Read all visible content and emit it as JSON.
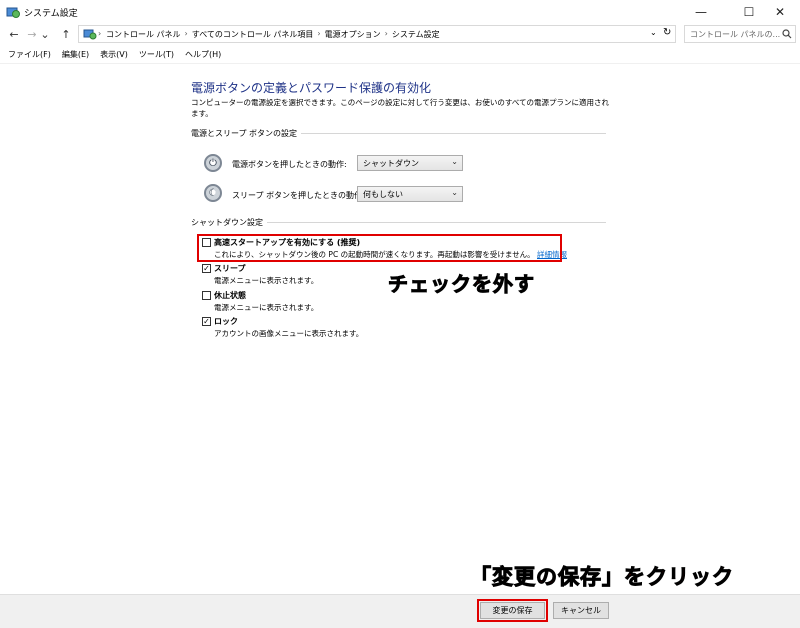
{
  "window": {
    "title": "システム設定",
    "min_glyph": "—",
    "max_glyph": "☐",
    "close_glyph": "✕"
  },
  "nav": {
    "back": "←",
    "forward": "→",
    "dropdown": "⌄",
    "up": "↑",
    "refresh": "↻",
    "address_dropdown": "⌄"
  },
  "breadcrumbs": [
    "コントロール パネル",
    "すべてのコントロール パネル項目",
    "電源オプション",
    "システム設定"
  ],
  "breadcrumb_separator": "›",
  "search": {
    "placeholder": "コントロール パネルの..."
  },
  "menu": [
    "ファイル(F)",
    "編集(E)",
    "表示(V)",
    "ツール(T)",
    "ヘルプ(H)"
  ],
  "page": {
    "heading": "電源ボタンの定義とパスワード保護の有効化",
    "description": "コンピューターの電源設定を選択できます。このページの設定に対して行う変更は、お使いのすべての電源プランに適用されます。"
  },
  "power_section": {
    "label": "電源とスリープ ボタンの設定",
    "power_button_label": "電源ボタンを押したときの動作:",
    "power_button_value": "シャットダウン",
    "sleep_button_label": "スリープ ボタンを押したときの動作:",
    "sleep_button_value": "何もしない"
  },
  "shutdown_section": {
    "label": "シャットダウン設定",
    "items": [
      {
        "label": "高速スタートアップを有効にする (推奨)",
        "desc": "これにより、シャットダウン後の PC の起動時間が速くなります。再起動は影響を受けません。",
        "link": "詳細情報",
        "checked": false
      },
      {
        "label": "スリープ",
        "desc": "電源メニューに表示されます。",
        "checked": true
      },
      {
        "label": "休止状態",
        "desc": "電源メニューに表示されます。",
        "checked": false
      },
      {
        "label": "ロック",
        "desc": "アカウントの画像メニューに表示されます。",
        "checked": true
      }
    ]
  },
  "annotations": {
    "uncheck": "チェックを外す",
    "click_save": "「変更の保存」をクリック"
  },
  "buttons": {
    "save": "変更の保存",
    "cancel": "キャンセル"
  },
  "colors": {
    "heading": "#1e3287",
    "highlight": "#e00000",
    "link": "#0066cc"
  },
  "icons": {
    "power_glyph": "⏻",
    "sleep_glyph": "☾",
    "check_glyph": "✓",
    "arrow_glyph": "⌄"
  }
}
